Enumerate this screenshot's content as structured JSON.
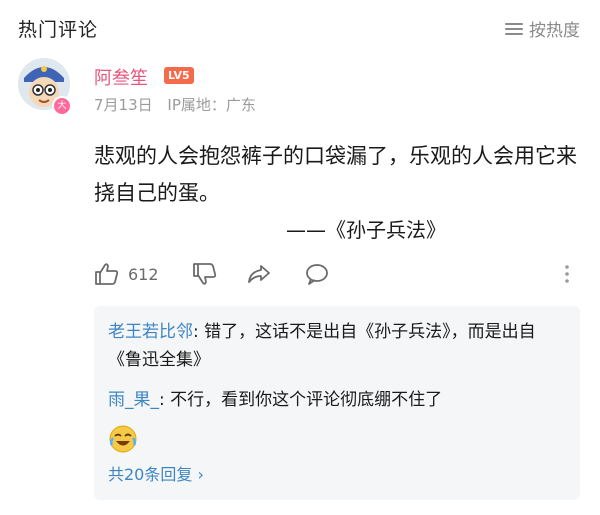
{
  "header": {
    "title": "热门评论",
    "sort_label": "按热度",
    "sort_icon": "list-sort-icon"
  },
  "comment": {
    "user_name": "阿叁笙",
    "level": "LV5",
    "date": "7月13日",
    "ip_location": "IP属地：广东",
    "text": "悲观的人会抱怨裤子的口袋漏了，乐观的人会用它来挠自己的蛋。",
    "signature": "——《孙子兵法》",
    "likes": "612",
    "colors": {
      "username": "#e8567e",
      "level_badge": "#f56a4a",
      "link": "#3d86c6"
    }
  },
  "replies": [
    {
      "name": "老王若比邻",
      "sep": ": ",
      "text": "错了，这话不是出自《孙子兵法》，而是出自《鲁迅全集》"
    },
    {
      "name": "雨_果_",
      "sep": ": ",
      "text": "不行，看到你这个评论彻底绷不住了"
    }
  ],
  "more_replies": "共20条回复 ›",
  "icons": [
    "thumb-up-icon",
    "thumb-down-icon",
    "share-icon",
    "comment-icon",
    "more-vertical-icon",
    "laughing-crying-emoji"
  ]
}
